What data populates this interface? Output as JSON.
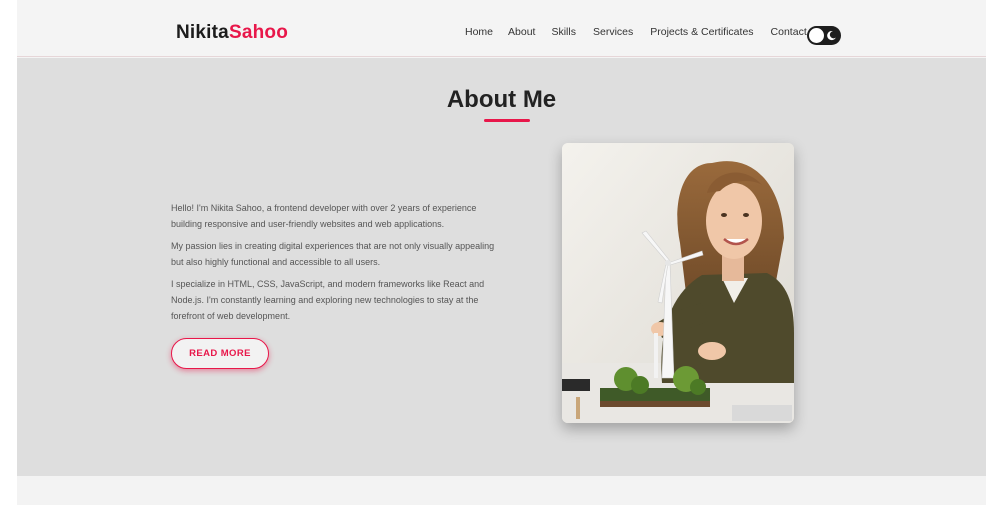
{
  "brand": {
    "first": "Nikita",
    "last": "Sahoo",
    "accent": "#e8174a"
  },
  "nav": {
    "items": [
      {
        "label": "Home"
      },
      {
        "label": "About"
      },
      {
        "label": "Skills"
      },
      {
        "label": "Services"
      },
      {
        "label": "Projects & Certificates"
      },
      {
        "label": "Contact"
      }
    ],
    "theme_toggle_icon": "moon-icon"
  },
  "about": {
    "title": "About Me",
    "paragraphs": [
      "Hello! I'm Nikita Sahoo, a frontend developer with over 2 years of experience building responsive and user-friendly websites and web applications.",
      "My passion lies in creating digital experiences that are not only visually appealing but also highly functional and accessible to all users.",
      "I specialize in HTML, CSS, JavaScript, and modern frameworks like React and Node.js. I'm constantly learning and exploring new technologies to stay at the forefront of web development."
    ],
    "read_more": "READ MORE"
  }
}
